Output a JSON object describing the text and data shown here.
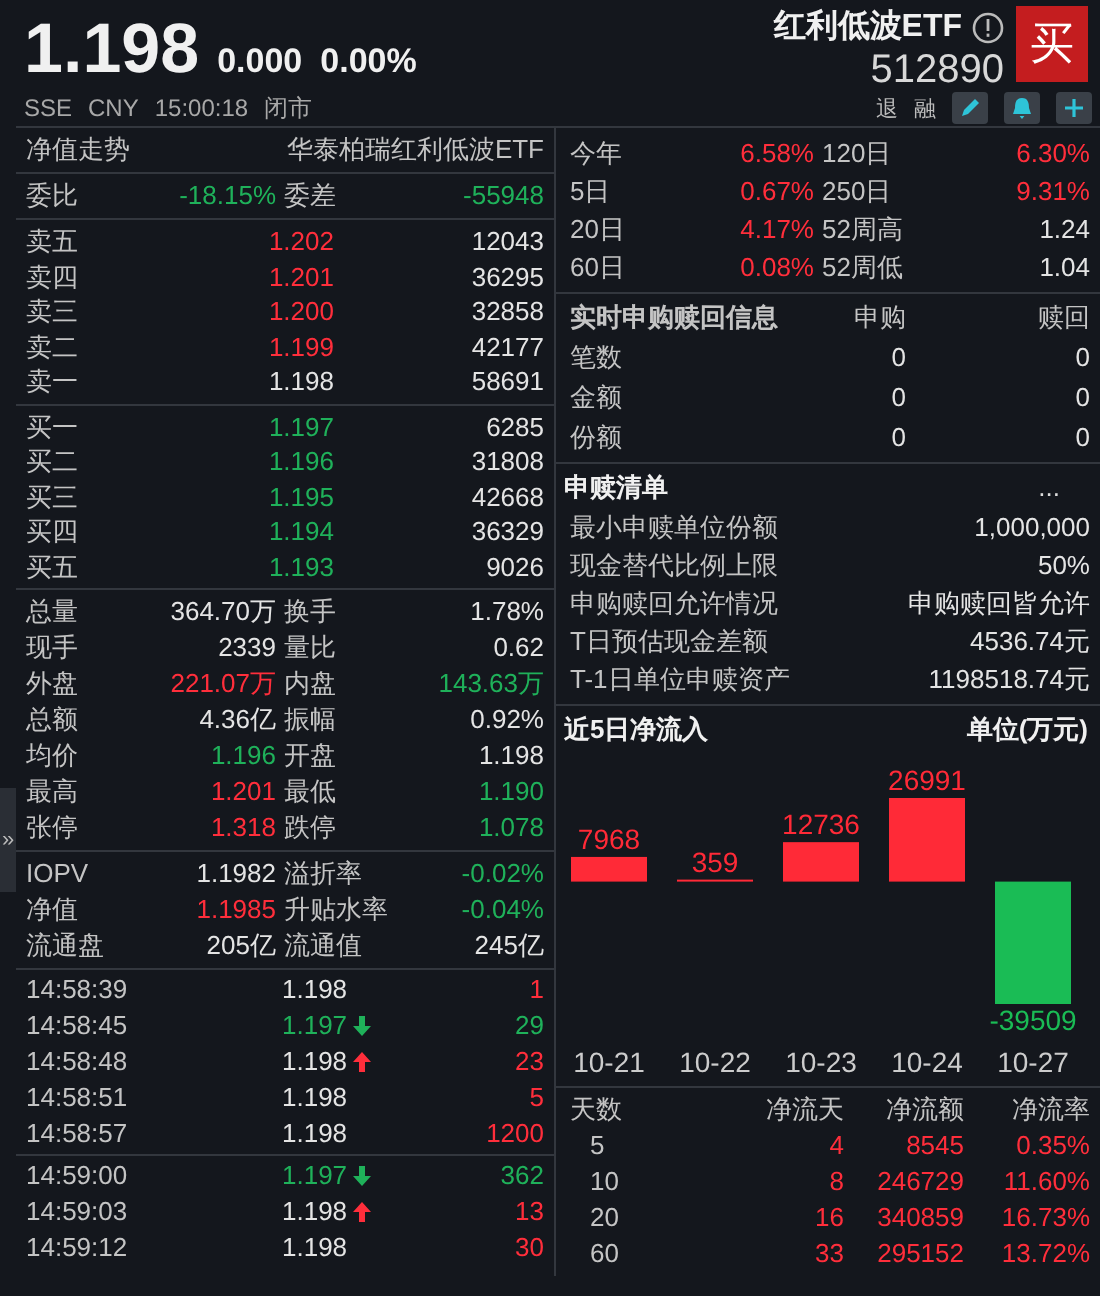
{
  "header": {
    "price": "1.198",
    "change": "0.000",
    "change_pct": "0.00%",
    "name": "红利低波ETF",
    "code": "512890",
    "buy_button": "买",
    "exchange": "SSE",
    "currency": "CNY",
    "time": "15:00:18",
    "status": "闭市",
    "tags": [
      "退",
      "融"
    ]
  },
  "left": {
    "title": "净值走势",
    "fund_name": "华泰柏瑞红利低波ETF",
    "ratio": [
      {
        "label": "委比",
        "value": "-18.15%",
        "color": "#1fb15a"
      },
      {
        "label": "委差",
        "value": "-55948",
        "color": "#1fb15a"
      }
    ],
    "asks": [
      {
        "label": "卖五",
        "price": "1.202",
        "volume": "12043",
        "color": "#ff2e3b"
      },
      {
        "label": "卖四",
        "price": "1.201",
        "volume": "36295",
        "color": "#ff2e3b"
      },
      {
        "label": "卖三",
        "price": "1.200",
        "volume": "32858",
        "color": "#ff2e3b"
      },
      {
        "label": "卖二",
        "price": "1.199",
        "volume": "42177",
        "color": "#ff2e3b"
      },
      {
        "label": "卖一",
        "price": "1.198",
        "volume": "58691",
        "color": "#e4e4e4"
      }
    ],
    "bids": [
      {
        "label": "买一",
        "price": "1.197",
        "volume": "6285",
        "color": "#1fb15a"
      },
      {
        "label": "买二",
        "price": "1.196",
        "volume": "31808",
        "color": "#1fb15a"
      },
      {
        "label": "买三",
        "price": "1.195",
        "volume": "42668",
        "color": "#1fb15a"
      },
      {
        "label": "买四",
        "price": "1.194",
        "volume": "36329",
        "color": "#1fb15a"
      },
      {
        "label": "买五",
        "price": "1.193",
        "volume": "9026",
        "color": "#1fb15a"
      }
    ],
    "stats": [
      [
        {
          "label": "总量",
          "value": "364.70万",
          "color": "#e4e4e4"
        },
        {
          "label": "换手",
          "value": "1.78%",
          "color": "#e4e4e4"
        }
      ],
      [
        {
          "label": "现手",
          "value": "2339",
          "color": "#e4e4e4"
        },
        {
          "label": "量比",
          "value": "0.62",
          "color": "#e4e4e4"
        }
      ],
      [
        {
          "label": "外盘",
          "value": "221.07万",
          "color": "#ff2e3b"
        },
        {
          "label": "内盘",
          "value": "143.63万",
          "color": "#1fb15a"
        }
      ],
      [
        {
          "label": "总额",
          "value": "4.36亿",
          "color": "#e4e4e4"
        },
        {
          "label": "振幅",
          "value": "0.92%",
          "color": "#e4e4e4"
        }
      ],
      [
        {
          "label": "均价",
          "value": "1.196",
          "color": "#1fb15a"
        },
        {
          "label": "开盘",
          "value": "1.198",
          "color": "#e4e4e4"
        }
      ],
      [
        {
          "label": "最高",
          "value": "1.201",
          "color": "#ff2e3b"
        },
        {
          "label": "最低",
          "value": "1.190",
          "color": "#1fb15a"
        }
      ],
      [
        {
          "label": "张停",
          "value": "1.318",
          "color": "#ff2e3b"
        },
        {
          "label": "跌停",
          "value": "1.078",
          "color": "#1fb15a"
        }
      ]
    ],
    "fund_stats": [
      [
        {
          "label": "IOPV",
          "value": "1.1982",
          "color": "#e4e4e4"
        },
        {
          "label": "溢折率",
          "value": "-0.02%",
          "color": "#1fb15a"
        }
      ],
      [
        {
          "label": "净值",
          "value": "1.1985",
          "color": "#ff2e3b"
        },
        {
          "label": "升贴水率",
          "value": "-0.04%",
          "color": "#1fb15a"
        }
      ],
      [
        {
          "label": "流通盘",
          "value": "205亿",
          "color": "#e4e4e4"
        },
        {
          "label": "流通值",
          "value": "245亿",
          "color": "#e4e4e4"
        }
      ]
    ],
    "ticks": [
      [
        {
          "time": "14:58:39",
          "price": {
            "value": "1.198",
            "color": "#e4e4e4"
          },
          "up_arrow": false,
          "down_arrow": false,
          "volume": {
            "value": "1",
            "color": "#ff2e3b"
          }
        },
        {
          "time": "14:58:45",
          "price": {
            "value": "1.197",
            "color": "#1fb15a"
          },
          "up_arrow": false,
          "down_arrow": true,
          "volume": {
            "value": "29",
            "color": "#1fb15a"
          }
        },
        {
          "time": "14:58:48",
          "price": {
            "value": "1.198",
            "color": "#e4e4e4"
          },
          "up_arrow": true,
          "down_arrow": false,
          "volume": {
            "value": "23",
            "color": "#ff2e3b"
          }
        },
        {
          "time": "14:58:51",
          "price": {
            "value": "1.198",
            "color": "#e4e4e4"
          },
          "up_arrow": false,
          "down_arrow": false,
          "volume": {
            "value": "5",
            "color": "#ff2e3b"
          }
        },
        {
          "time": "14:58:57",
          "price": {
            "value": "1.198",
            "color": "#e4e4e4"
          },
          "up_arrow": false,
          "down_arrow": false,
          "volume": {
            "value": "1200",
            "color": "#ff2e3b"
          }
        }
      ],
      [
        {
          "time": "14:59:00",
          "price": {
            "value": "1.197",
            "color": "#1fb15a"
          },
          "up_arrow": false,
          "down_arrow": true,
          "volume": {
            "value": "362",
            "color": "#1fb15a"
          }
        },
        {
          "time": "14:59:03",
          "price": {
            "value": "1.198",
            "color": "#e4e4e4"
          },
          "up_arrow": true,
          "down_arrow": false,
          "volume": {
            "value": "13",
            "color": "#ff2e3b"
          }
        },
        {
          "time": "14:59:12",
          "price": {
            "value": "1.198",
            "color": "#e4e4e4"
          },
          "up_arrow": false,
          "down_arrow": false,
          "volume": {
            "value": "30",
            "color": "#ff2e3b"
          }
        }
      ]
    ],
    "expand_handle": "»"
  },
  "right": {
    "returns": [
      [
        {
          "label": "今年",
          "value": "6.58%",
          "color": "#ff2e3b"
        },
        {
          "label": "120日",
          "value": "6.30%",
          "color": "#ff2e3b"
        }
      ],
      [
        {
          "label": "5日",
          "value": "0.67%",
          "color": "#ff2e3b"
        },
        {
          "label": "250日",
          "value": "9.31%",
          "color": "#ff2e3b"
        }
      ],
      [
        {
          "label": "20日",
          "value": "4.17%",
          "color": "#ff2e3b"
        },
        {
          "label": "52周高",
          "value": "1.24",
          "color": "#e4e4e4"
        }
      ],
      [
        {
          "label": "60日",
          "value": "0.08%",
          "color": "#ff2e3b"
        },
        {
          "label": "52周低",
          "value": "1.04",
          "color": "#e4e4e4"
        }
      ]
    ],
    "realtime": {
      "title": "实时申购赎回信息",
      "columns": [
        "申购",
        "赎回"
      ],
      "rows": [
        {
          "label": "笔数",
          "subscribe": "0",
          "redeem": "0"
        },
        {
          "label": "金额",
          "subscribe": "0",
          "redeem": "0"
        },
        {
          "label": "份额",
          "subscribe": "0",
          "redeem": "0"
        }
      ]
    },
    "creation_list": {
      "title": "申赎清单",
      "more": "...",
      "rows": [
        {
          "label": "最小申赎单位份额",
          "value": "1,000,000"
        },
        {
          "label": "现金替代比例上限",
          "value": "50%"
        },
        {
          "label": "申购赎回允许情况",
          "value": "申购赎回皆允许"
        },
        {
          "label": "T日预估现金差额",
          "value": "4536.74元"
        },
        {
          "label": "T-1日单位申赎资产",
          "value": "1198518.74元"
        }
      ]
    },
    "net_inflow": {
      "title": "近5日净流入",
      "unit": "单位(万元)",
      "chart_data": {
        "type": "bar",
        "categories": [
          "10-21",
          "10-22",
          "10-23",
          "10-24",
          "10-27"
        ],
        "series": [
          {
            "values": [
              7968,
              359,
              12736,
              26991,
              -39509
            ]
          }
        ],
        "data_labels": true
      }
    },
    "flow_table": {
      "columns": [
        "天数",
        "净流天",
        "净流额",
        "净流率"
      ],
      "rows": [
        {
          "days": "5",
          "net_days": "4",
          "net_amount": "8545",
          "net_rate": "0.35%",
          "color": "#ff2e3b"
        },
        {
          "days": "10",
          "net_days": "8",
          "net_amount": "246729",
          "net_rate": "11.60%",
          "color": "#ff2e3b"
        },
        {
          "days": "20",
          "net_days": "16",
          "net_amount": "340859",
          "net_rate": "16.73%",
          "color": "#ff2e3b"
        },
        {
          "days": "60",
          "net_days": "33",
          "net_amount": "295152",
          "net_rate": "13.72%",
          "color": "#ff2e3b"
        }
      ]
    }
  }
}
